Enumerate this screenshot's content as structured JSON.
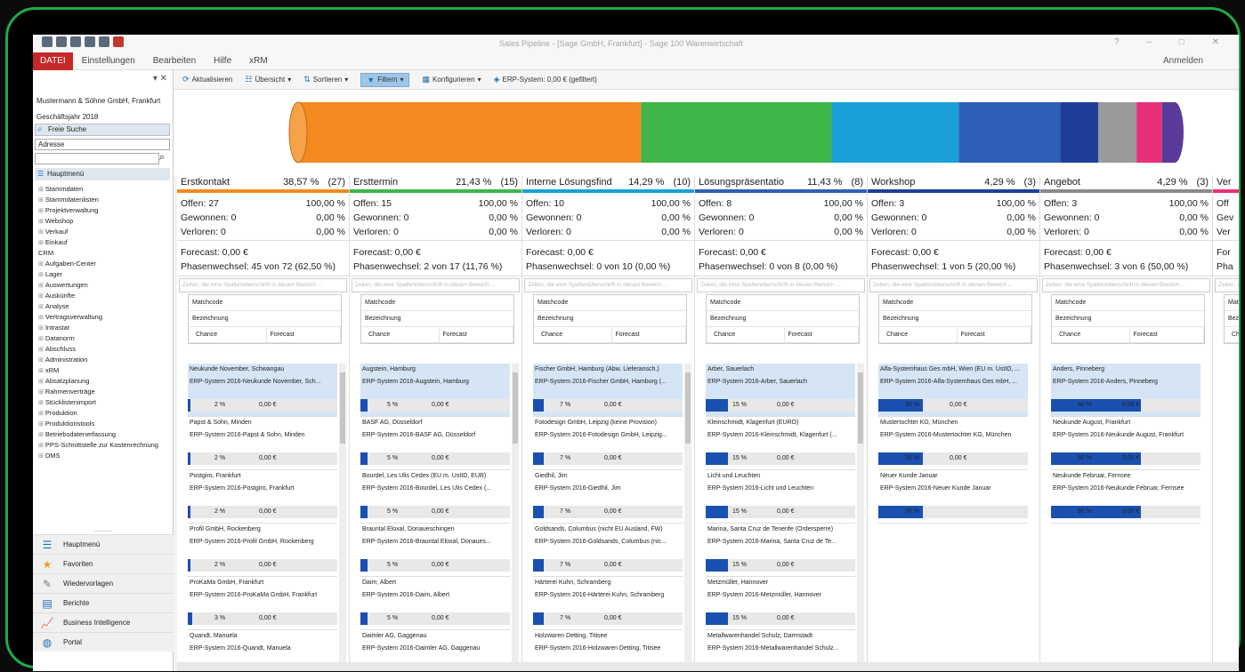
{
  "titlebar": {
    "title": "Sales Pipeline - [Sage GmbH, Frankfurt] - Sage 100 Warenwirtschaft",
    "controls": "? – □ ✕"
  },
  "menubar": {
    "datei": "DATEI",
    "items": [
      "Einstellungen",
      "Bearbeiten",
      "Hilfe",
      "xRM"
    ],
    "user": "Anmelden"
  },
  "sidebar": {
    "company": "Mustermann & Söhne GmbH, Frankfurt",
    "year": "Geschäftsjahr 2018",
    "free_search": "Freie Suche",
    "search_field": "Adresse",
    "main_menu": "Hauptmenü",
    "tree": [
      "Stammdaten",
      "Stammdatenlisten",
      "Projektverwaltung",
      "Webshop",
      "Verkauf",
      "Einkauf",
      "CRM",
      "Aufgaben-Center",
      "Lager",
      "Auswertungen",
      "Auskünfte",
      "Analyse",
      "Vertragsverwaltung",
      "Intrastat",
      "Datanorm",
      "Abschluss",
      "Administration",
      "xRM",
      "Absatzplanung",
      "Rahmenverträge",
      "Stücklistenimport",
      "Produktion",
      "Produktionstools",
      "Betriebsdatenerfassung",
      "PPS-Schnittstelle zur Kostenrechnung",
      "DMS"
    ],
    "bottom": [
      {
        "label": "Hauptmenü",
        "icon": "main-menu-icon"
      },
      {
        "label": "Favoriten",
        "icon": "star-icon"
      },
      {
        "label": "Wiedervorlagen",
        "icon": "pencil-icon"
      },
      {
        "label": "Berichte",
        "icon": "printer-icon"
      },
      {
        "label": "Business Intelligence",
        "icon": "chart-icon"
      },
      {
        "label": "Portal",
        "icon": "globe-icon"
      }
    ]
  },
  "toolbar": {
    "items": [
      "Aktualisieren",
      "Übersicht",
      "Sortieren",
      "Filtern",
      "Konfigurieren",
      "ERP-System: 0,00 € (gefiltert)"
    ]
  },
  "funnel": {
    "segments": [
      {
        "color": "#f28a1f",
        "share": 38.57
      },
      {
        "color": "#3fb54a",
        "share": 21.43
      },
      {
        "color": "#1aa0d8",
        "share": 14.29
      },
      {
        "color": "#2e5fb8",
        "share": 11.43
      },
      {
        "color": "#1d3f9a",
        "share": 4.29
      },
      {
        "color": "#9a9a9a",
        "share": 4.29
      },
      {
        "color": "#e8307a",
        "share": 2.86
      },
      {
        "color": "#5a3a9a",
        "share": 1.43
      }
    ]
  },
  "card_header": {
    "matchcode": "Matchcode",
    "bezeichnung": "Bezeichnung",
    "chance": "Chance",
    "forecast": "Forecast"
  },
  "filter_placeholder": "Zeilen, die eine Spaltenüberschrift in diesen Bereich ...",
  "phases": [
    {
      "name": "Erstkontakt",
      "pct": "38,57 %",
      "count": "(27)",
      "color": "#f28a1f",
      "offen": "Offen: 27",
      "offen_p": "100,00 %",
      "gew": "Gewonnen: 0",
      "gew_p": "0,00 %",
      "verl": "Verloren: 0",
      "verl_p": "0,00 %",
      "forecast": "Forecast: 0,00 €",
      "wechsel": "Phasenwechsel: 45 von 72 (62,50 %)",
      "cards": [
        {
          "l1": "Neukunde November, Schwangau",
          "l2": "ERP-System 2016-Neukunde November, Sch...",
          "pct": "2 %",
          "fv": "0,00 €",
          "fill": 0.02
        },
        {
          "l1": "Papst & Sohn, Minden",
          "l2": "ERP-System 2016-Papst & Sohn, Minden",
          "pct": "2 %",
          "fv": "0,00 €",
          "fill": 0.02
        },
        {
          "l1": "Postgiro, Frankfurt",
          "l2": "ERP-System 2016-Postgiro, Frankfurt",
          "pct": "2 %",
          "fv": "0,00 €",
          "fill": 0.02
        },
        {
          "l1": "Profil GmbH, Rockenberg",
          "l2": "ERP-System 2016-Profil GmbH, Rockenberg",
          "pct": "2 %",
          "fv": "0,00 €",
          "fill": 0.02
        },
        {
          "l1": "ProKaMa GmbH, Frankfurt",
          "l2": "ERP-System 2016-ProKaMa GmbH, Frankfurt",
          "pct": "3 %",
          "fv": "0,00 €",
          "fill": 0.03
        },
        {
          "l1": "Quandt, Manuela",
          "l2": "ERP-System 2016-Quandt, Manuela",
          "pct": "2 %",
          "fv": "0,00 €",
          "fill": 0.02
        }
      ]
    },
    {
      "name": "Ersttermin",
      "pct": "21,43 %",
      "count": "(15)",
      "color": "#3fb54a",
      "offen": "Offen: 15",
      "offen_p": "100,00 %",
      "gew": "Gewonnen: 0",
      "gew_p": "0,00 %",
      "verl": "Verloren: 0",
      "verl_p": "0,00 %",
      "forecast": "Forecast: 0,00 €",
      "wechsel": "Phasenwechsel: 2 von 17 (11,76 %)",
      "cards": [
        {
          "l1": "Augstein, Hamburg",
          "l2": "ERP-System 2016-Augstein, Hamburg",
          "pct": "5 %",
          "fv": "0,00 €",
          "fill": 0.05
        },
        {
          "l1": "BASF AG, Düsseldorf",
          "l2": "ERP-System 2016-BASF AG, Düsseldorf",
          "pct": "5 %",
          "fv": "0,00 €",
          "fill": 0.05
        },
        {
          "l1": "Bourdel, Les Ulis Cedex (EU m. UstID, EUR)",
          "l2": "ERP-System 2016-Bourdel, Les Ulis Cedex (...",
          "pct": "5 %",
          "fv": "0,00 €",
          "fill": 0.05
        },
        {
          "l1": "Brauntal Eloxal, Donaueschingen",
          "l2": "ERP-System 2016-Brauntal Eloxal, Donaues...",
          "pct": "5 %",
          "fv": "0,00 €",
          "fill": 0.05
        },
        {
          "l1": "Daim, Albert",
          "l2": "ERP-System 2016-Daim, Albert",
          "pct": "5 %",
          "fv": "0,00 €",
          "fill": 0.05
        },
        {
          "l1": "Daimler AG, Gaggenau",
          "l2": "ERP-System 2016-Daimler AG, Gaggenau",
          "pct": "5 %",
          "fv": "0,00 €",
          "fill": 0.05
        }
      ]
    },
    {
      "name": "Interne Lösungsfindung",
      "pct": "14,29 %",
      "count": "(10)",
      "color": "#1aa0d8",
      "offen": "Offen: 10",
      "offen_p": "100,00 %",
      "gew": "Gewonnen: 0",
      "gew_p": "0,00 %",
      "verl": "Verloren: 0",
      "verl_p": "0,00 %",
      "forecast": "Forecast: 0,00 €",
      "wechsel": "Phasenwechsel: 0 von 10 (0,00 %)",
      "cards": [
        {
          "l1": "Fischer GmbH, Hamburg (Abw. Lieferansch.)",
          "l2": "ERP-System 2016-Fischer GmbH, Hamburg (...",
          "pct": "7 %",
          "fv": "0,00 €",
          "fill": 0.07
        },
        {
          "l1": "Fotodesign GmbH, Leipzig (keine Provision)",
          "l2": "ERP-System 2016-Fotodesign GmbH, Leipzig...",
          "pct": "7 %",
          "fv": "0,00 €",
          "fill": 0.07
        },
        {
          "l1": "Giedhil, Jim",
          "l2": "ERP-System 2016-Giedhil, Jim",
          "pct": "7 %",
          "fv": "0,00 €",
          "fill": 0.07
        },
        {
          "l1": "Goldsands, Columbus (nicht EU Ausland, FW)",
          "l2": "ERP-System 2016-Goldsands, Columbus (nic...",
          "pct": "7 %",
          "fv": "0,00 €",
          "fill": 0.07
        },
        {
          "l1": "Härterei Kuhn, Schramberg",
          "l2": "ERP-System 2016-Härterei Kuhn, Schramberg",
          "pct": "7 %",
          "fv": "0,00 €",
          "fill": 0.07
        },
        {
          "l1": "Holzwaren Detting, Titisee",
          "l2": "ERP-System 2016-Holzwaren Detting, Titisee",
          "pct": "7 %",
          "fv": "0,00 €",
          "fill": 0.07
        }
      ]
    },
    {
      "name": "Lösungspräsentation",
      "pct": "11,43 %",
      "count": "(8)",
      "color": "#2e5fb8",
      "offen": "Offen: 8",
      "offen_p": "100,00 %",
      "gew": "Gewonnen: 0",
      "gew_p": "0,00 %",
      "verl": "Verloren: 0",
      "verl_p": "0,00 %",
      "forecast": "Forecast: 0,00 €",
      "wechsel": "Phasenwechsel: 0 von 8 (0,00 %)",
      "cards": [
        {
          "l1": "Arber, Sauerlach",
          "l2": "ERP-System 2016-Arber, Sauerlach",
          "pct": "15 %",
          "fv": "0,00 €",
          "fill": 0.15
        },
        {
          "l1": "Kleinschmidt, Klagenfurt (EURO)",
          "l2": "ERP-System 2016-Kleinschmidt, Klagenfurt (...",
          "pct": "15 %",
          "fv": "0,00 €",
          "fill": 0.15
        },
        {
          "l1": "Licht und Leuchten",
          "l2": "ERP-System 2016-Licht und Leuchten",
          "pct": "15 %",
          "fv": "0,00 €",
          "fill": 0.15
        },
        {
          "l1": "Marina, Santa Cruz de Tenerife (Ordersperre)",
          "l2": "ERP-System 2016-Marina, Santa Cruz de Te...",
          "pct": "15 %",
          "fv": "0,00 €",
          "fill": 0.15
        },
        {
          "l1": "Metzmüller, Hannover",
          "l2": "ERP-System 2016-Metzmüller, Hannover",
          "pct": "15 %",
          "fv": "0,00 €",
          "fill": 0.15
        },
        {
          "l1": "Metallwarenhandel Schulz, Darmstadt",
          "l2": "ERP-System 2016-Metallwarenhandel Schulz...",
          "pct": "15 %",
          "fv": "0,00 €",
          "fill": 0.15
        }
      ]
    },
    {
      "name": "Workshop",
      "pct": "4,29 %",
      "count": "(3)",
      "color": "#1d3f9a",
      "offen": "Offen: 3",
      "offen_p": "100,00 %",
      "gew": "Gewonnen: 0",
      "gew_p": "0,00 %",
      "verl": "Verloren: 0",
      "verl_p": "0,00 %",
      "forecast": "Forecast: 0,00 €",
      "wechsel": "Phasenwechsel: 1 von 5 (20,00 %)",
      "cards": [
        {
          "l1": "Alfa-Systemhaus Ges mbH, Wien (EU m. UstID, ...",
          "l2": "ERP-System 2016-Alfa-Systemhaus Ges mbH, ...",
          "pct": "30 %",
          "fv": "0,00 €",
          "fill": 0.3
        },
        {
          "l1": "Mustertochter KG, München",
          "l2": "ERP-System 2016-Mustertochter KG, München",
          "pct": "30 %",
          "fv": "0,00 €",
          "fill": 0.3
        },
        {
          "l1": "Neuer Kunde Januar",
          "l2": "ERP-System 2016-Neuer Kunde Januar",
          "pct": "30 %",
          "fv": "",
          "fill": 0.3
        }
      ]
    },
    {
      "name": "Angebot",
      "pct": "4,29 %",
      "count": "(3)",
      "color": "#8a8a8a",
      "offen": "Offen: 3",
      "offen_p": "100,00 %",
      "gew": "Gewonnen: 0",
      "gew_p": "0,00 %",
      "verl": "Verloren: 0",
      "verl_p": "0,00 %",
      "forecast": "Forecast: 0,00 €",
      "wechsel": "Phasenwechsel: 3 von 6 (50,00 %)",
      "cards": [
        {
          "l1": "Anders, Pinneberg",
          "l2": "ERP-System 2016-Anders, Pinneberg",
          "pct": "60 %",
          "fv": "0,00 €",
          "fill": 0.6
        },
        {
          "l1": "Neukunde August, Frankfurt",
          "l2": "ERP-System 2016-Neukunde August, Frankfurt",
          "pct": "60 %",
          "fv": "0,00 €",
          "fill": 0.6
        },
        {
          "l1": "Neukunde Februar, Fernsee",
          "l2": "ERP-System 2016-Neukunde Februar, Fernsee",
          "pct": "60 %",
          "fv": "0,00 €",
          "fill": 0.6
        }
      ]
    },
    {
      "name": "Ver",
      "pct": "",
      "count": "",
      "color": "#e8307a",
      "offen": "Off",
      "offen_p": "",
      "gew": "Gev",
      "gew_p": "",
      "verl": "Ver",
      "verl_p": "",
      "forecast": "For",
      "wechsel": "Pha",
      "cards": []
    }
  ]
}
